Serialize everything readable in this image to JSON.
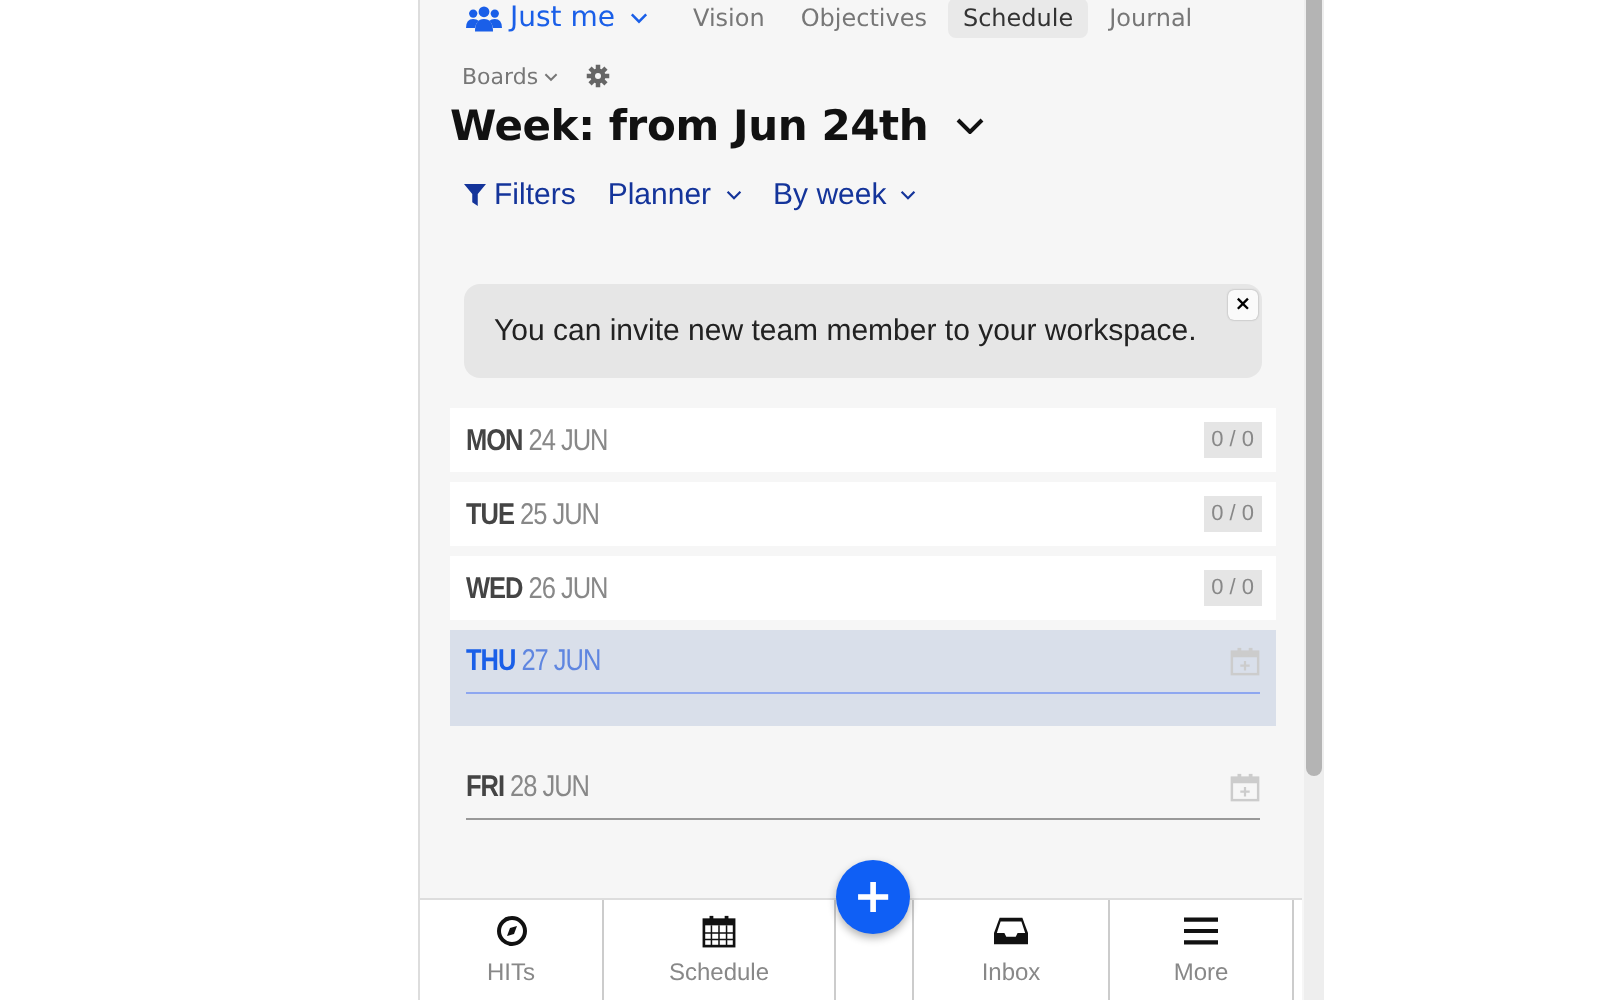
{
  "nav": {
    "team": "Just me",
    "links": [
      {
        "label": "Vision",
        "selected": false
      },
      {
        "label": "Objectives",
        "selected": false
      },
      {
        "label": "Schedule",
        "selected": true
      },
      {
        "label": "Journal",
        "selected": false
      },
      {
        "label": "Boards",
        "selected": false
      }
    ]
  },
  "title": "Week: from Jun 24th",
  "toolbar": [
    "Filters",
    "Planner",
    "By week"
  ],
  "notice": {
    "text": "You can invite new team member to your workspace.",
    "close": "×"
  },
  "days": [
    {
      "kind": "collapsed",
      "weekday": "MON",
      "date": "24 JUN",
      "count": "0 / 0",
      "selected": false
    },
    {
      "kind": "collapsed",
      "weekday": "TUE",
      "date": "25 JUN",
      "count": "0 / 0",
      "selected": false
    },
    {
      "kind": "collapsed",
      "weekday": "WED",
      "date": "26 JUN",
      "count": "0 / 0",
      "selected": false
    },
    {
      "kind": "expanded",
      "weekday": "THU",
      "date": "27 JUN",
      "selected": true
    },
    {
      "kind": "expanded",
      "weekday": "FRI",
      "date": "28 JUN",
      "selected": false
    }
  ],
  "fab": "+",
  "tabbar": [
    "HITs",
    "Schedule",
    "Inbox",
    "More"
  ]
}
